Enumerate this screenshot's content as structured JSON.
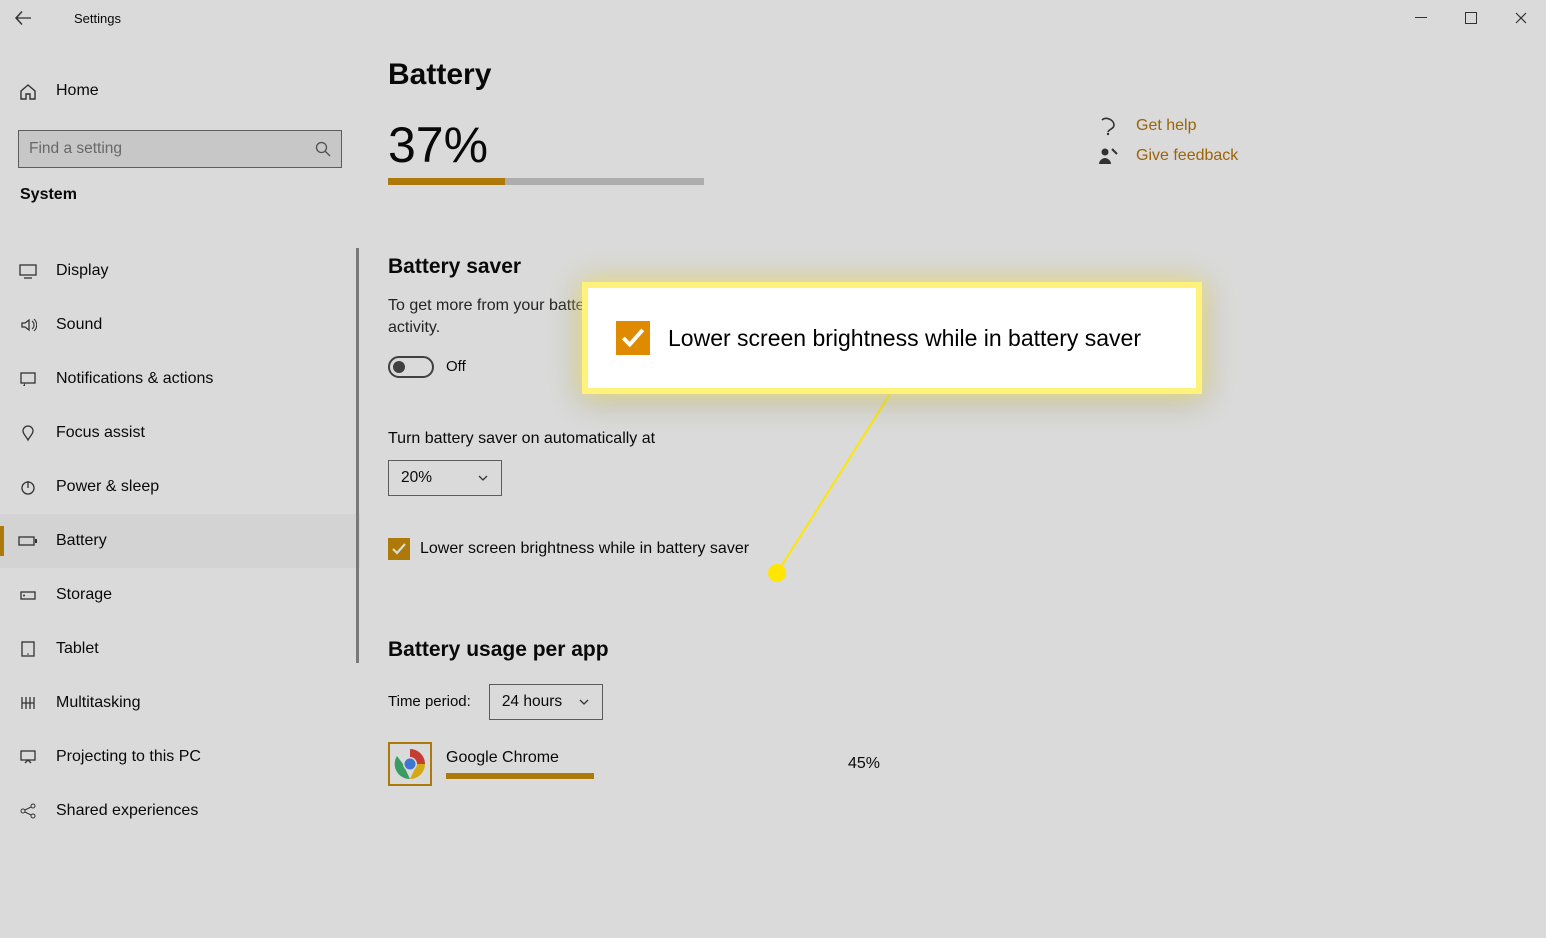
{
  "titlebar": {
    "app_title": "Settings"
  },
  "sidebar": {
    "home": "Home",
    "search_placeholder": "Find a setting",
    "section_label": "System",
    "items": [
      {
        "label": "Display"
      },
      {
        "label": "Sound"
      },
      {
        "label": "Notifications & actions"
      },
      {
        "label": "Focus assist"
      },
      {
        "label": "Power & sleep"
      },
      {
        "label": "Battery"
      },
      {
        "label": "Storage"
      },
      {
        "label": "Tablet"
      },
      {
        "label": "Multitasking"
      },
      {
        "label": "Projecting to this PC"
      },
      {
        "label": "Shared experiences"
      }
    ]
  },
  "content": {
    "page_title": "Battery",
    "percent_label": "37%",
    "percent_value": 37,
    "saver_heading": "Battery saver",
    "saver_desc": "To get more from your battery when it's low, limit notifications and background activity.",
    "toggle_label": "Off",
    "auto_label": "Turn battery saver on automatically at",
    "auto_value": "20%",
    "lower_brightness_label": "Lower screen brightness while in battery saver",
    "usage_heading": "Battery usage per app",
    "time_period_label": "Time period:",
    "time_period_value": "24 hours",
    "apps": [
      {
        "name": "Google Chrome",
        "pct": "45%"
      }
    ]
  },
  "right": {
    "get_help": "Get help",
    "give_feedback": "Give feedback"
  },
  "callout": {
    "text": "Lower screen brightness while in battery saver"
  }
}
